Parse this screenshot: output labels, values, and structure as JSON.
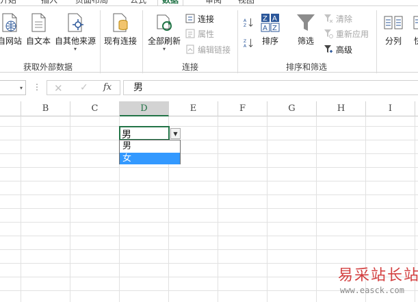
{
  "tabs": [
    {
      "label": "开始",
      "active": false
    },
    {
      "label": "插入",
      "active": false
    },
    {
      "label": "页面布局",
      "active": false
    },
    {
      "label": "公式",
      "active": false
    },
    {
      "label": "数据",
      "active": true
    },
    {
      "label": "审阅",
      "active": false
    },
    {
      "label": "视图",
      "active": false
    }
  ],
  "ribbon": {
    "external_data": {
      "group_label": "获取外部数据",
      "from_web": "自网站",
      "from_text": "自文本",
      "from_other": "自其他来源",
      "existing_connections": "现有连接"
    },
    "connections": {
      "group_label": "连接",
      "refresh_all": "全部刷新",
      "connections": "连接",
      "properties": "属性",
      "edit_links": "编辑链接"
    },
    "sort_filter": {
      "group_label": "排序和筛选",
      "sort": "排序",
      "filter": "筛选",
      "clear": "清除",
      "reapply": "重新应用",
      "advanced": "高级"
    },
    "data_tools": {
      "text_to_columns": "分列",
      "flash_fill": "快"
    }
  },
  "formula_bar": {
    "fx": "fx",
    "value": "男"
  },
  "grid": {
    "columns": [
      "B",
      "C",
      "D",
      "E",
      "F",
      "G",
      "H",
      "I"
    ],
    "selected_column": "D",
    "active_cell_value": "男"
  },
  "dropdown": {
    "options": [
      "男",
      "女"
    ],
    "highlighted_index": 1
  },
  "watermark": {
    "text": "易采站长站",
    "url": "www.easck.com"
  },
  "colors": {
    "accent": "#217346",
    "selection": "#3399ff",
    "watermark": "#d33f3f"
  }
}
